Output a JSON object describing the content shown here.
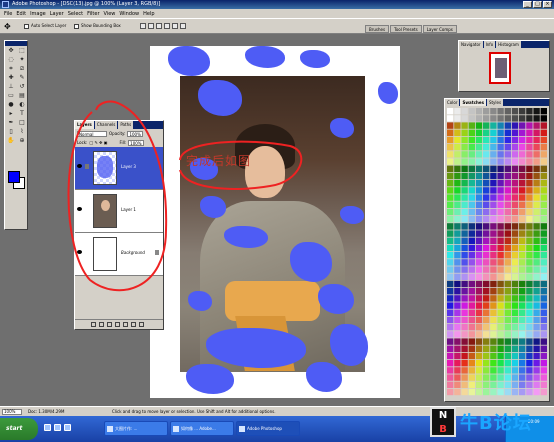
{
  "app": {
    "title": "Adobe Photoshop - [DSC(13).jpg @ 100% (Layer 3, RGB/8)]",
    "window_buttons": [
      "_",
      "□",
      "×"
    ]
  },
  "menu": [
    "File",
    "Edit",
    "Image",
    "Layer",
    "Select",
    "Filter",
    "View",
    "Window",
    "Help"
  ],
  "options_bar": {
    "tool_icon": "move-tool-icon",
    "auto_select_label": "Auto Select Layer",
    "bounding_box_label": "Show Bounding Box",
    "well_tabs": [
      "Brushes",
      "Tool Presets",
      "Layer Comps"
    ]
  },
  "toolbox": {
    "tools": [
      "move",
      "marquee",
      "lasso",
      "magic-wand",
      "crop",
      "slice",
      "healing",
      "brush",
      "stamp",
      "history-brush",
      "eraser",
      "gradient",
      "blur",
      "dodge",
      "path",
      "type",
      "pen",
      "shape",
      "notes",
      "eyedropper",
      "hand",
      "zoom"
    ],
    "foreground_color": "#0000ff",
    "background_color": "#ffffff"
  },
  "annotation": {
    "text": "完成后如图",
    "color": "#c0392b"
  },
  "layers_palette": {
    "tabs": [
      "Layers",
      "Channels",
      "Paths"
    ],
    "blend_mode": "Normal",
    "opacity_label": "Opacity:",
    "opacity_value": "100%",
    "lock_label": "Lock:",
    "fill_label": "Fill:",
    "fill_value": "100%",
    "layers": [
      {
        "name": "Layer 3",
        "selected": true
      },
      {
        "name": "Layer 1",
        "selected": false
      },
      {
        "name": "Background",
        "selected": false
      }
    ]
  },
  "navigator": {
    "tabs": [
      "Navigator",
      "Info",
      "Histogram"
    ]
  },
  "swatches_palette": {
    "tabs": [
      "Color",
      "Swatches",
      "Styles"
    ]
  },
  "status": {
    "zoom": "100%",
    "doc_info": "Doc: 1.30M/4.29M",
    "hint": "Click and drag to move layer or selection. Use Shift and Alt for additional options."
  },
  "taskbar": {
    "start_label": "start",
    "tasks": [
      "大图片作: ...",
      "如何像 ... Adobe...",
      "Adobe Photoshop"
    ],
    "tray_time": "20:09"
  },
  "watermark": {
    "badge_top": "N",
    "badge_bottom": "B",
    "text": "牛B论坛"
  }
}
